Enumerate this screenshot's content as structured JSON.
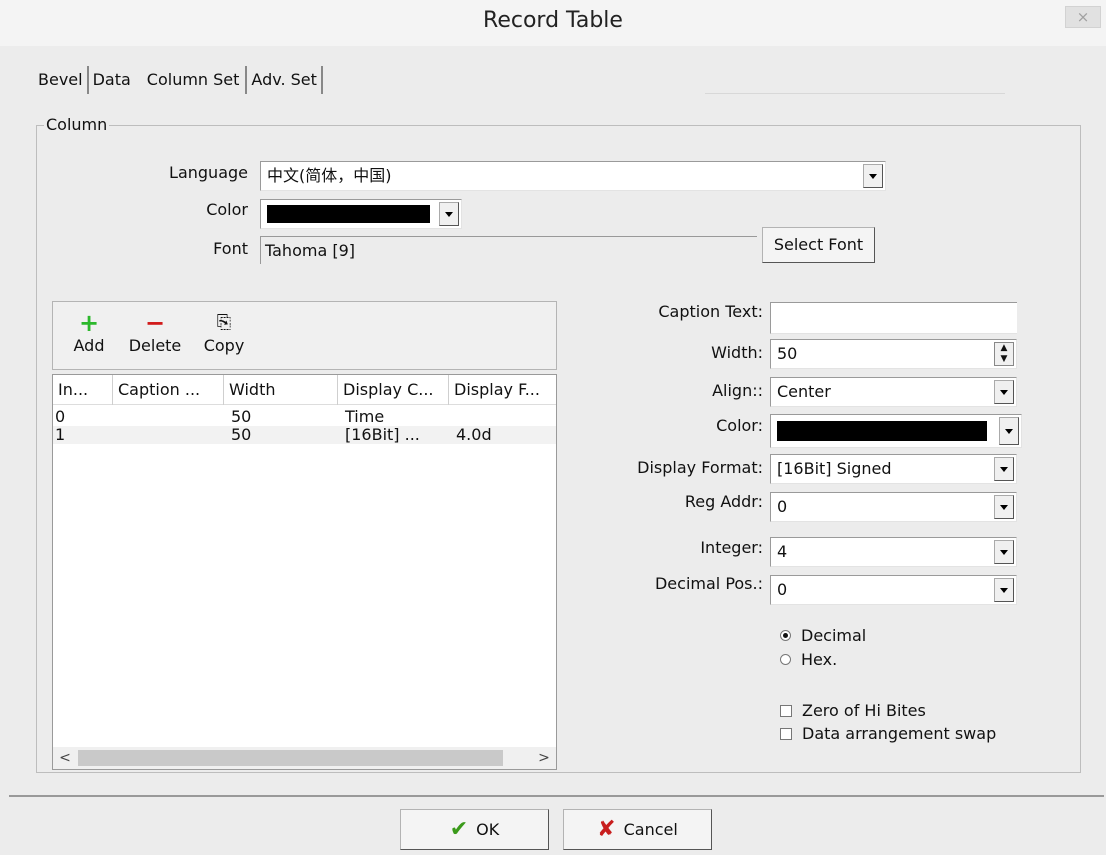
{
  "window": {
    "title": "Record Table",
    "close_glyph": "×"
  },
  "tabs": [
    {
      "label": "Bevel"
    },
    {
      "label": "Data"
    },
    {
      "label": "Column Set"
    },
    {
      "label": "Adv. Set"
    }
  ],
  "column_group": {
    "label": "Column",
    "language_label": "Language",
    "language_value": "中文(简体，中国)",
    "color_label": "Color",
    "color_value": "#000000",
    "font_label": "Font",
    "font_value": "Tahoma [9]",
    "select_font_label": "Select Font"
  },
  "toolbar": {
    "add_label": "Add",
    "delete_label": "Delete",
    "copy_label": "Copy"
  },
  "list": {
    "columns": [
      "In...",
      "Caption ...",
      "Width",
      "Display C...",
      "Display F..."
    ],
    "rows": [
      {
        "index": "0",
        "caption": "",
        "width": "50",
        "display_content": "Time",
        "display_format": ""
      },
      {
        "index": "1",
        "caption": "",
        "width": "50",
        "display_content": "[16Bit] ...",
        "display_format": "4.0d"
      }
    ],
    "scroll_left": "<",
    "scroll_right": ">"
  },
  "props": {
    "caption_text_label": "Caption Text:",
    "caption_text_value": "",
    "width_label": "Width:",
    "width_value": "50",
    "align_label": "Align::",
    "align_value": "Center",
    "color_label": "Color:",
    "color_value": "#000000",
    "display_format_label": "Display Format:",
    "display_format_value": "[16Bit] Signed",
    "reg_addr_label": "Reg Addr:",
    "reg_addr_value": "0",
    "integer_label": "Integer:",
    "integer_value": "4",
    "decimal_pos_label": "Decimal Pos.:",
    "decimal_pos_value": "0",
    "radio_decimal": "Decimal",
    "radio_hex": "Hex.",
    "check_zero_hi": "Zero of Hi Bites",
    "check_swap": "Data arrangement swap"
  },
  "footer": {
    "ok_label": "OK",
    "cancel_label": "Cancel"
  }
}
